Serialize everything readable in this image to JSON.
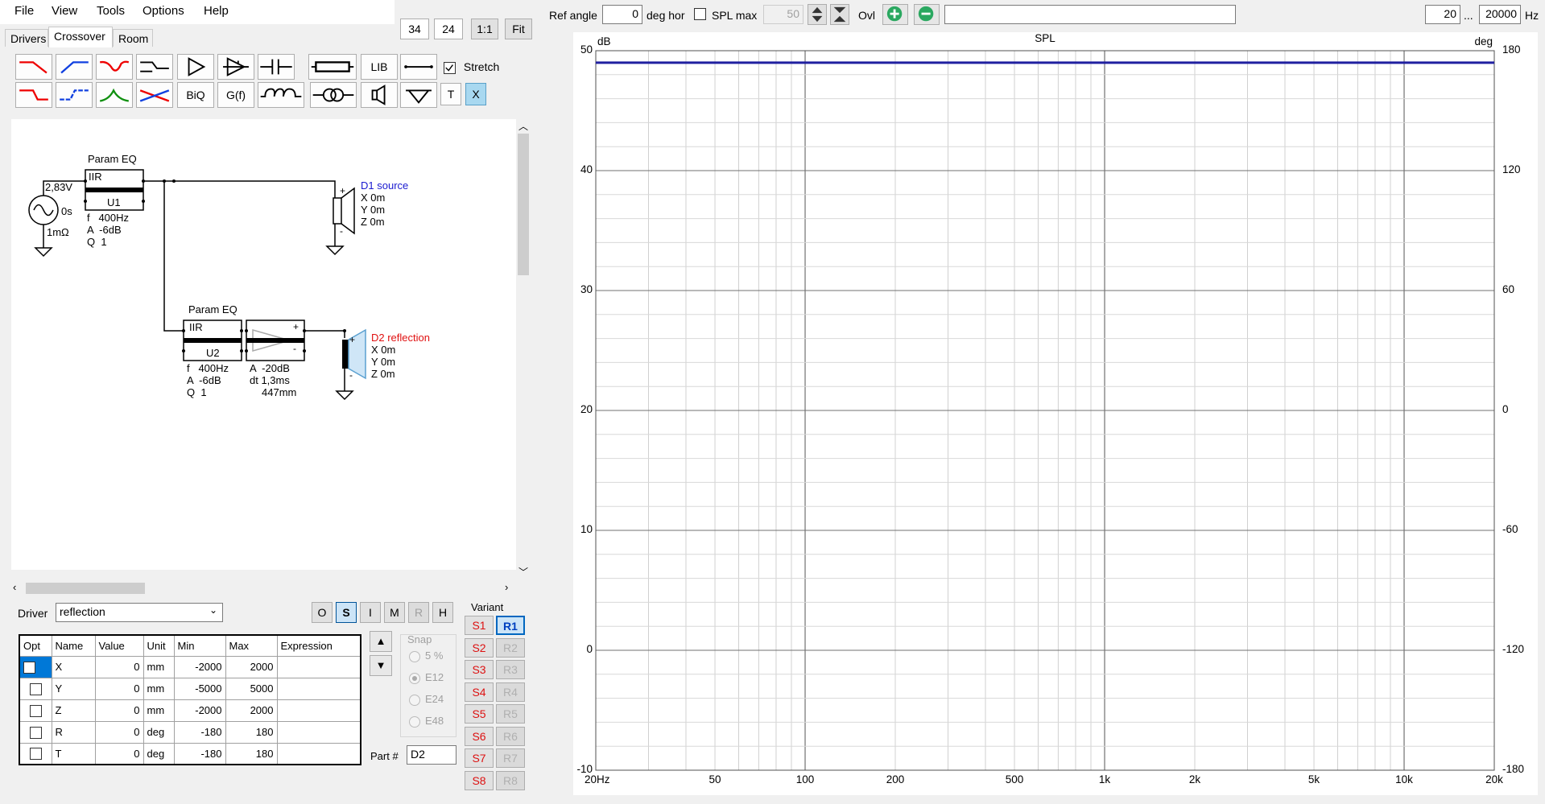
{
  "menu": [
    "File",
    "View",
    "Tools",
    "Options",
    "Help"
  ],
  "tabs": [
    "Drivers",
    "Crossover",
    "Room"
  ],
  "active_tab": 1,
  "zoom_boxes": [
    "34",
    "24"
  ],
  "zoom_buttons": [
    "1:1",
    "Fit"
  ],
  "toolbar": {
    "lib_label": "LIB",
    "biq_label": "BiQ",
    "gf_label": "G(f)",
    "t_label": "T",
    "x_label": "X",
    "stretch_label": "Stretch",
    "stretch_checked": true
  },
  "schematic": {
    "source": {
      "voltage": "2,83V",
      "delay": "0s",
      "resistance": "1mΩ"
    },
    "eq1": {
      "title": "Param EQ",
      "type": "IIR",
      "id": "U1",
      "f": "f   400Hz",
      "a": "A  -6dB",
      "q": "Q  1"
    },
    "d1": {
      "name": "D1 source",
      "x": "X 0m",
      "y": "Y 0m",
      "z": "Z 0m",
      "color": "#1a1ad0"
    },
    "eq2": {
      "title": "Param EQ",
      "type": "IIR",
      "id": "U2",
      "f": "f   400Hz",
      "a": "A  -6dB",
      "q": "Q  1"
    },
    "delay": {
      "a": "A  -20dB",
      "dt": "dt 1,3ms",
      "dist": "447mm"
    },
    "d2": {
      "name": "D2 reflection",
      "x": "X 0m",
      "y": "Y 0m",
      "z": "Z 0m",
      "color": "#e01010"
    }
  },
  "driver": {
    "label": "Driver",
    "value": "reflection"
  },
  "mode_buttons": [
    "O",
    "S",
    "I",
    "M",
    "R",
    "H"
  ],
  "mode_selected": "S",
  "mode_disabled": [
    "R"
  ],
  "params": {
    "headers": [
      "Opt",
      "Name",
      "Value",
      "Unit",
      "Min",
      "Max",
      "Expression"
    ],
    "rows": [
      {
        "name": "X",
        "value": "0",
        "unit": "mm",
        "min": "-2000",
        "max": "2000",
        "expr": ""
      },
      {
        "name": "Y",
        "value": "0",
        "unit": "mm",
        "min": "-5000",
        "max": "5000",
        "expr": ""
      },
      {
        "name": "Z",
        "value": "0",
        "unit": "mm",
        "min": "-2000",
        "max": "2000",
        "expr": ""
      },
      {
        "name": "R",
        "value": "0",
        "unit": "deg",
        "min": "-180",
        "max": "180",
        "expr": ""
      },
      {
        "name": "T",
        "value": "0",
        "unit": "deg",
        "min": "-180",
        "max": "180",
        "expr": ""
      }
    ]
  },
  "snap": {
    "label": "Snap",
    "options": [
      "5 %",
      "E12",
      "E24",
      "E48"
    ],
    "selected": "E12"
  },
  "part": {
    "label": "Part #",
    "value": "D2"
  },
  "variant": {
    "label": "Variant",
    "s": [
      "S1",
      "S2",
      "S3",
      "S4",
      "S5",
      "S6",
      "S7",
      "S8"
    ],
    "r": [
      "R1",
      "R2",
      "R3",
      "R4",
      "R5",
      "R6",
      "R7",
      "R8"
    ],
    "selected": "R1"
  },
  "topbar": {
    "ref_angle_label": "Ref angle",
    "ref_angle": "0",
    "deg_hor_label": "deg hor",
    "spl_max_label": "SPL max",
    "spl_max": "50",
    "ovl_label": "Ovl",
    "fmin": "20",
    "ellipsis": "...",
    "fmax": "20000",
    "hz_label": "Hz"
  },
  "chart_data": {
    "type": "line",
    "title": "SPL",
    "ylabel": "dB",
    "y2label": "deg",
    "xscale": "log",
    "xlim": [
      20,
      20000
    ],
    "ylim": [
      -10,
      50
    ],
    "y2lim": [
      -180,
      180
    ],
    "x_ticks": [
      "20Hz",
      "50",
      "100",
      "200",
      "500",
      "1k",
      "2k",
      "5k",
      "10k",
      "20k"
    ],
    "x_tick_values": [
      20,
      50,
      100,
      200,
      500,
      1000,
      2000,
      5000,
      10000,
      20000
    ],
    "y_ticks": [
      50,
      40,
      30,
      20,
      10,
      0,
      -10
    ],
    "y2_ticks": [
      180,
      120,
      60,
      0,
      -60,
      -120,
      -180
    ],
    "grid": true,
    "series": [
      {
        "x": [
          20,
          20000
        ],
        "y": [
          49,
          49
        ],
        "color": "#2020a0"
      }
    ]
  }
}
